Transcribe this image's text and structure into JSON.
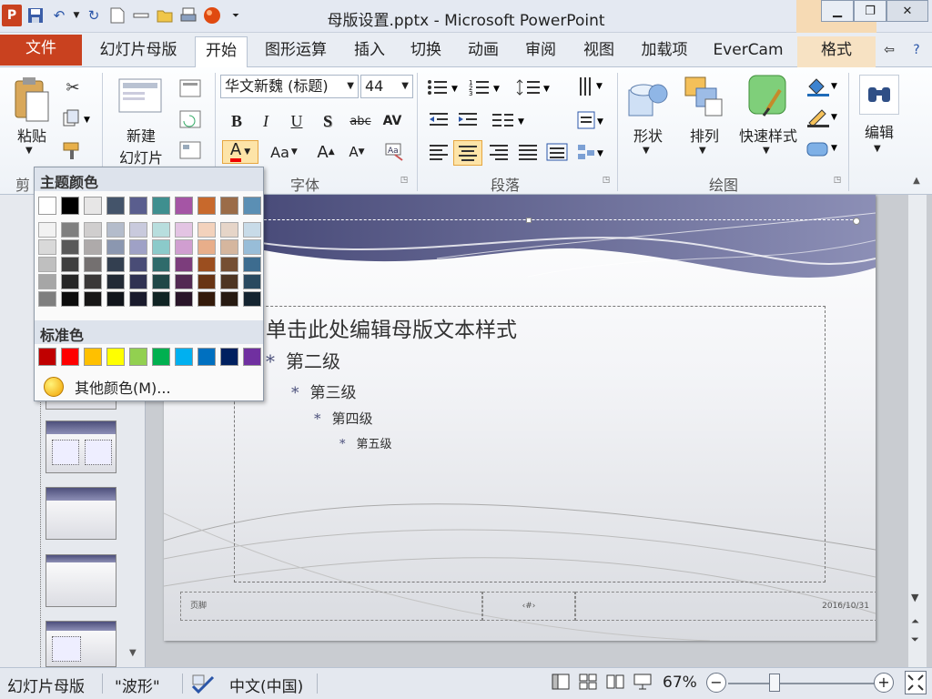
{
  "window": {
    "title": "母版设置.pptx - Microsoft PowerPoint",
    "app_icon": "P",
    "controls": [
      "minimize",
      "restore",
      "close"
    ]
  },
  "tabs": [
    {
      "label": "文件",
      "kind": "file"
    },
    {
      "label": "幻灯片母版"
    },
    {
      "label": "开始",
      "active": true
    },
    {
      "label": "图形运算"
    },
    {
      "label": "插入"
    },
    {
      "label": "切换"
    },
    {
      "label": "动画"
    },
    {
      "label": "审阅"
    },
    {
      "label": "视图"
    },
    {
      "label": "加载项"
    },
    {
      "label": "EverCam"
    },
    {
      "label": "格式",
      "contextual": true
    }
  ],
  "ribbon": {
    "clipboard": {
      "paste_label": "粘贴",
      "group_label": "剪"
    },
    "slides": {
      "new_slide_line1": "新建",
      "new_slide_line2": "幻灯片"
    },
    "font": {
      "font_name": "华文新魏 (标题)",
      "font_size": "44",
      "group_label": "字体",
      "buttons": [
        "B",
        "I",
        "U",
        "S",
        "abc",
        "AV",
        "A",
        "Aa",
        "A",
        "A"
      ]
    },
    "paragraph": {
      "group_label": "段落"
    },
    "drawing": {
      "shapes_label": "形状",
      "arrange_label": "排列",
      "quick_styles_label": "快速样式",
      "group_label": "绘图"
    },
    "editing": {
      "label": "编辑"
    }
  },
  "color_dropdown": {
    "theme_title": "主题颜色",
    "standard_title": "标准色",
    "more_colors": "其他颜色(M)...",
    "theme_base": [
      "#ffffff",
      "#000000",
      "#e7e6e6",
      "#44546a",
      "#5a5e8e",
      "#3f8f8f",
      "#a555a5",
      "#c8692c",
      "#9b6c48",
      "#5b8fb4"
    ],
    "theme_shades": [
      [
        "#f2f2f2",
        "#7f7f7f",
        "#d0cece",
        "#b4bccb",
        "#c9cadd",
        "#b8dede",
        "#e3c4e3",
        "#f3d2bc",
        "#e6d5c8",
        "#c8dbe8"
      ],
      [
        "#d9d9d9",
        "#595959",
        "#aeaaaa",
        "#8b97b0",
        "#9fa1c6",
        "#8bcaca",
        "#d09ed0",
        "#e8ae8a",
        "#d5b69e",
        "#98bdd8"
      ],
      [
        "#bfbfbf",
        "#3f3f3f",
        "#747070",
        "#333f50",
        "#494c76",
        "#2f6b6b",
        "#7c3d7c",
        "#9b4e1f",
        "#754f33",
        "#3d6c8f"
      ],
      [
        "#a6a6a6",
        "#262626",
        "#3a3838",
        "#222a35",
        "#303252",
        "#1f4747",
        "#522952",
        "#683414",
        "#4e3522",
        "#29495f"
      ],
      [
        "#7f7f7f",
        "#0c0c0c",
        "#171616",
        "#11151b",
        "#191a2c",
        "#102424",
        "#291529",
        "#341a0a",
        "#271a11",
        "#142430"
      ]
    ],
    "standard": [
      "#c00000",
      "#ff0000",
      "#ffc000",
      "#ffff00",
      "#92d050",
      "#00b050",
      "#00b0f0",
      "#0070c0",
      "#002060",
      "#7030a0"
    ]
  },
  "slide": {
    "levels": [
      "单击此处编辑母版文本样式",
      "第二级",
      "第三级",
      "第四级",
      "第五级"
    ],
    "footer_left": "页脚",
    "footer_center": "‹#›",
    "footer_right": "2016/10/31"
  },
  "statusbar": {
    "view": "幻灯片母版",
    "theme": "\"波形\"",
    "language": "中文(中国)",
    "zoom": "67%"
  },
  "colors": {
    "file_tab": "#c9411f",
    "accent_band": "#5a5e8e"
  }
}
